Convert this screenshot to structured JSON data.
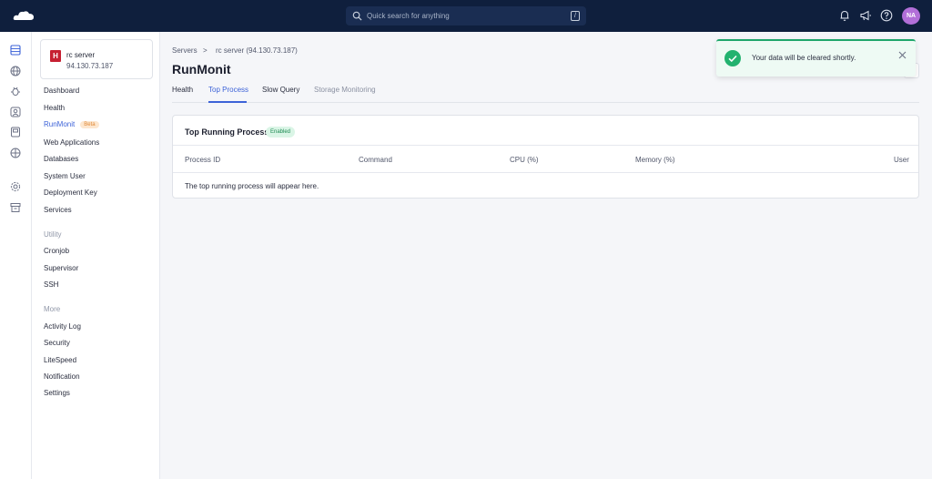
{
  "topbar": {
    "search_placeholder": "Quick search for anything",
    "search_shortcut": "/",
    "avatar_initials": "NA"
  },
  "server": {
    "badge": "H",
    "name": "rc server",
    "ip": "94.130.73.187"
  },
  "menu": {
    "items": [
      "Dashboard",
      "Health",
      "RunMonit",
      "Web Applications",
      "Databases",
      "System User",
      "Deployment Key",
      "Services"
    ],
    "active_badge": "Beta",
    "utility_heading": "Utility",
    "utility_items": [
      "Cronjob",
      "Supervisor",
      "SSH"
    ],
    "more_heading": "More",
    "more_items": [
      "Activity Log",
      "Security",
      "LiteSpeed",
      "Notification",
      "Settings"
    ]
  },
  "breadcrumb": {
    "root": "Servers",
    "separator": ">",
    "current": "rc server (94.130.73.187)"
  },
  "page": {
    "title": "RunMonit",
    "tabs": [
      "Health",
      "Top Process",
      "Slow Query",
      "Storage Monitoring"
    ],
    "active_tab": "Top Process"
  },
  "panel": {
    "title": "Top Running Process",
    "status": "Enabled",
    "columns": [
      "Process ID",
      "Command",
      "CPU (%)",
      "Memory (%)",
      "User"
    ],
    "empty_message": "The top running process will appear here."
  },
  "toast": {
    "message": "Your data will be cleared shortly.",
    "color": "#23b26f"
  },
  "colors": {
    "topbar": "#0f1f3d",
    "accent": "#3d63d8",
    "brand_badge": "#c62032"
  }
}
